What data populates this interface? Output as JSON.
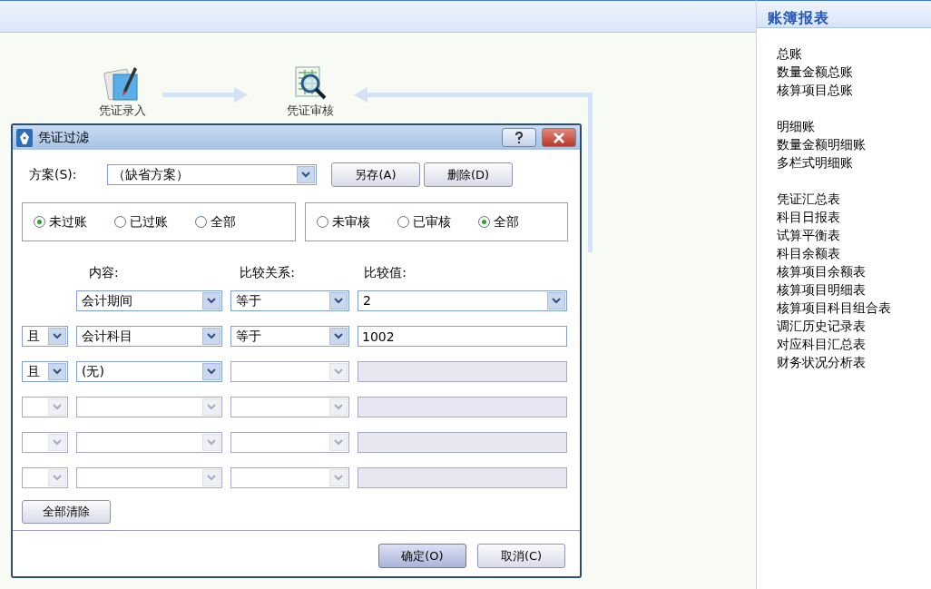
{
  "flow": {
    "nodes": [
      {
        "label": "凭证录入",
        "kind": "entry"
      },
      {
        "label": "凭证审核",
        "kind": "review"
      }
    ]
  },
  "sidebar": {
    "title": "账簿报表",
    "groups": [
      {
        "items": [
          "总账",
          "数量金额总账",
          "核算项目总账"
        ]
      },
      {
        "items": [
          "明细账",
          "数量金额明细账",
          "多栏式明细账"
        ]
      },
      {
        "items": [
          "凭证汇总表",
          "科目日报表",
          "试算平衡表",
          "科目余额表",
          "核算项目余额表",
          "核算项目明细表",
          "核算项目科目组合表",
          "调汇历史记录表",
          "对应科目汇总表",
          "财务状况分析表"
        ]
      }
    ]
  },
  "dialog": {
    "title": "凭证过滤",
    "scheme": {
      "label": "方案(S):",
      "value": "（缺省方案）"
    },
    "scheme_buttons": [
      "另存(A)",
      "删除(D)"
    ],
    "posting_options": [
      {
        "label": "未过账",
        "selected": true
      },
      {
        "label": "已过账",
        "selected": false
      },
      {
        "label": "全部",
        "selected": false
      }
    ],
    "audit_options": [
      {
        "label": "未审核",
        "selected": false
      },
      {
        "label": "已审核",
        "selected": false
      },
      {
        "label": "全部",
        "selected": true
      }
    ],
    "columns": [
      "内容:",
      "比较关系:",
      "比较值:"
    ],
    "rows": [
      {
        "kind": "first",
        "field": {
          "text": "会计期间",
          "disabled": false
        },
        "relation": {
          "text": "等于",
          "disabled": false
        },
        "value": {
          "kind": "dropdown",
          "text": "2",
          "disabled": false
        }
      },
      {
        "kind": "joined",
        "logic": {
          "text": "且",
          "disabled": false
        },
        "field": {
          "text": "会计科目",
          "disabled": false
        },
        "relation": {
          "text": "等于",
          "disabled": false
        },
        "value": {
          "kind": "text",
          "text": "1002",
          "disabled": false
        }
      },
      {
        "kind": "joined",
        "logic": {
          "text": "且",
          "disabled": false
        },
        "field": {
          "text": "(无)",
          "disabled": false
        },
        "relation": {
          "disabled": true
        },
        "value": {
          "kind": "text",
          "disabled": true
        }
      },
      {
        "kind": "joined",
        "logic": {
          "disabled": true
        },
        "field": {
          "disabled": true
        },
        "relation": {
          "disabled": true
        },
        "value": {
          "kind": "text",
          "disabled": true
        }
      },
      {
        "kind": "joined",
        "logic": {
          "disabled": true
        },
        "field": {
          "disabled": true
        },
        "relation": {
          "disabled": true
        },
        "value": {
          "kind": "text",
          "disabled": true
        }
      },
      {
        "kind": "joined",
        "logic": {
          "disabled": true
        },
        "field": {
          "disabled": true
        },
        "relation": {
          "disabled": true
        },
        "value": {
          "kind": "text",
          "disabled": true
        }
      }
    ],
    "clear_button": "全部清除",
    "footer_buttons": [
      {
        "label": "确定(O)",
        "default": true
      },
      {
        "label": "取消(C)",
        "default": false
      }
    ]
  }
}
